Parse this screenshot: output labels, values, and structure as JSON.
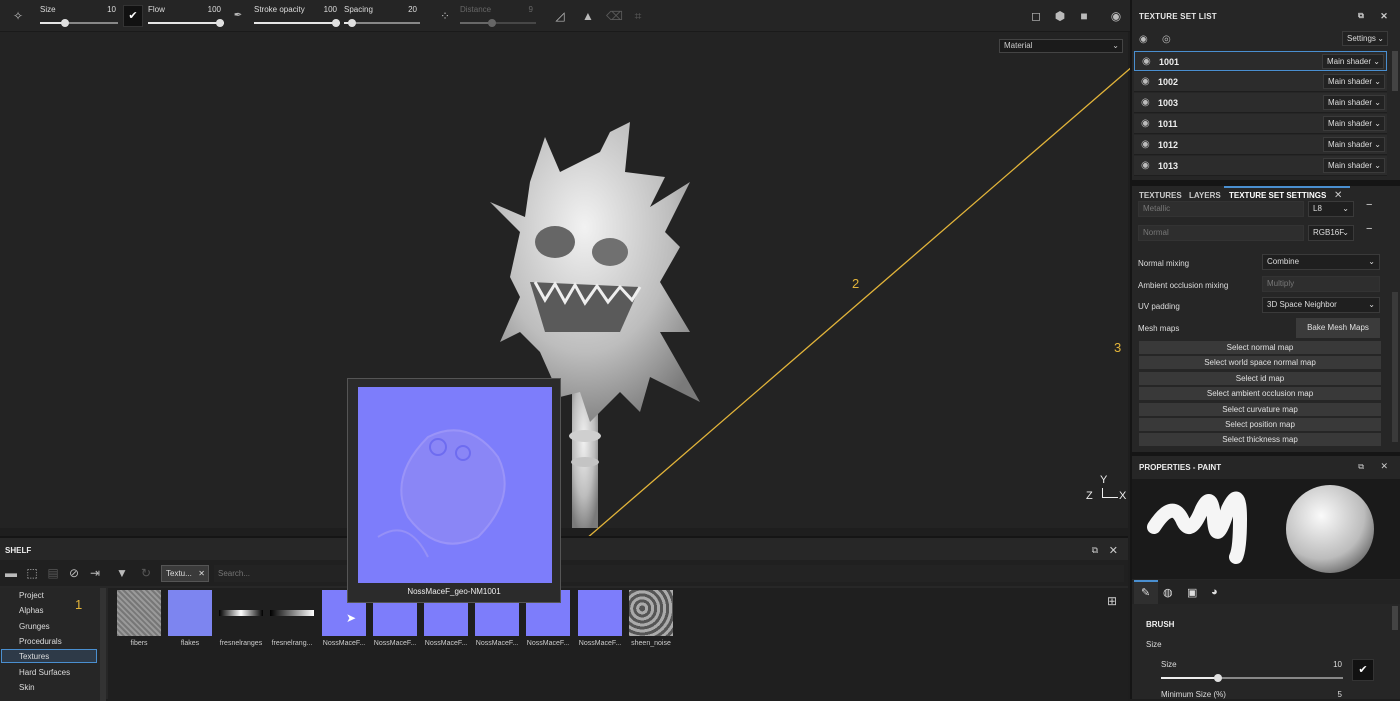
{
  "toolbar": {
    "size_label": "Size",
    "size_value": "10",
    "flow_label": "Flow",
    "flow_value": "100",
    "stroke_opacity_label": "Stroke opacity",
    "stroke_opacity_value": "100",
    "spacing_label": "Spacing",
    "spacing_value": "20",
    "distance_label": "Distance",
    "distance_value": "9",
    "size_level": 0.3,
    "flow_level": 1.0,
    "stroke_opacity_level": 1.0,
    "spacing_level": 0.1,
    "distance_level": 0.4
  },
  "viewport": {
    "material_select": "Material",
    "axis_y": "Y",
    "axis_z": "Z",
    "axis_x": "X"
  },
  "texture_set_list": {
    "title": "TEXTURE SET LIST",
    "settings_label": "Settings",
    "rows": [
      {
        "name": "1001",
        "shader": "Main shader"
      },
      {
        "name": "1002",
        "shader": "Main shader"
      },
      {
        "name": "1003",
        "shader": "Main shader"
      },
      {
        "name": "1011",
        "shader": "Main shader"
      },
      {
        "name": "1012",
        "shader": "Main shader"
      },
      {
        "name": "1013",
        "shader": "Main shader"
      }
    ]
  },
  "tabs": {
    "textures": "TEXTURES",
    "layers": "LAYERS",
    "texture_set_settings": "TEXTURE SET SETTINGS"
  },
  "tss": {
    "metallic": "Metallic",
    "metallic_format": "L8",
    "normal": "Normal",
    "normal_format": "RGB16F",
    "normal_mixing_label": "Normal mixing",
    "normal_mixing_value": "Combine",
    "ao_mixing_label": "Ambient occlusion mixing",
    "ao_mixing_value": "Multiply",
    "uv_padding_label": "UV padding",
    "uv_padding_value": "3D Space Neighbor",
    "mesh_maps_label": "Mesh maps",
    "bake_label": "Bake Mesh Maps",
    "maps": [
      "Select normal map",
      "Select world space normal map",
      "Select id map",
      "Select ambient occlusion map",
      "Select curvature map",
      "Select position map",
      "Select thickness map"
    ]
  },
  "properties": {
    "title": "PROPERTIES - PAINT",
    "brush_heading": "BRUSH",
    "size_group": "Size",
    "size_label": "Size",
    "size_value": "10",
    "min_size_label": "Minimum Size (%)",
    "min_size_value": "5"
  },
  "shelf": {
    "title": "SHELF",
    "filter_chip": "Textu...",
    "search_placeholder": "Search...",
    "categories": [
      "Project",
      "Alphas",
      "Grunges",
      "Procedurals",
      "Textures",
      "Hard Surfaces",
      "Skin"
    ],
    "thumbs": [
      "fibers",
      "flakes",
      "fresnelranges",
      "fresnelrang...",
      "NossMaceF...",
      "NossMaceF...",
      "NossMaceF...",
      "NossMaceF...",
      "NossMaceF...",
      "NossMaceF...",
      "sheen_noise"
    ],
    "preview_label": "NossMaceF_geo-NM1001"
  },
  "annotations": {
    "a1": "1",
    "a2": "2",
    "a3": "3"
  },
  "colors": {
    "annotation": "#e2b43a",
    "normal_map": "#7d7dfb",
    "selection": "#4a8fd0"
  }
}
